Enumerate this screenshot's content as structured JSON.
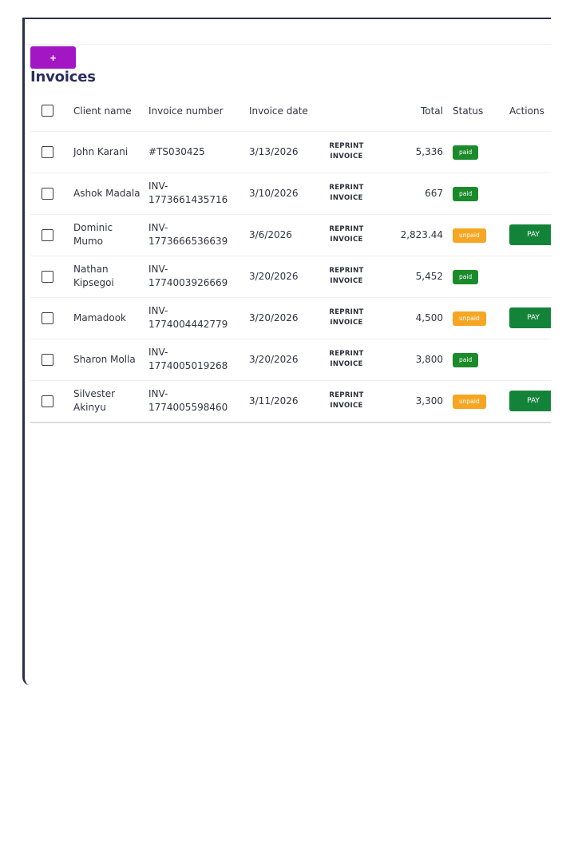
{
  "toolbar": {
    "add_label": "+"
  },
  "page": {
    "title": "Invoices"
  },
  "table": {
    "headers": {
      "client": "Client name",
      "number": "Invoice number",
      "date": "Invoice date",
      "total": "Total",
      "status": "Status",
      "actions": "Actions"
    },
    "rows": [
      {
        "client": "John Karani",
        "number": "#TS030425",
        "date": "3/13/2026",
        "reprint": "REPRINT INVOICE",
        "total": "5,336",
        "status": "paid",
        "action": ""
      },
      {
        "client": "Ashok Madala",
        "number": "INV-1773661435716",
        "date": "3/10/2026",
        "reprint": "REPRINT INVOICE",
        "total": "667",
        "status": "paid",
        "action": ""
      },
      {
        "client": "Dominic Mumo",
        "number": "INV-1773666536639",
        "date": "3/6/2026",
        "reprint": "REPRINT INVOICE",
        "total": "2,823.44",
        "status": "unpaid",
        "action": "PAY"
      },
      {
        "client": "Nathan Kipsegoi",
        "number": "INV-1774003926669",
        "date": "3/20/2026",
        "reprint": "REPRINT INVOICE",
        "total": "5,452",
        "status": "paid",
        "action": ""
      },
      {
        "client": "Mamadook",
        "number": "INV-1774004442779",
        "date": "3/20/2026",
        "reprint": "REPRINT INVOICE",
        "total": "4,500",
        "status": "unpaid",
        "action": "PAY"
      },
      {
        "client": "Sharon Molla",
        "number": "INV-1774005019268",
        "date": "3/20/2026",
        "reprint": "REPRINT INVOICE",
        "total": "3,800",
        "status": "paid",
        "action": ""
      },
      {
        "client": "Silvester Akinyu",
        "number": "INV-1774005598460",
        "date": "3/11/2026",
        "reprint": "REPRINT INVOICE",
        "total": "3,300",
        "status": "unpaid",
        "action": "PAY"
      }
    ]
  },
  "colors": {
    "accent": "#a316c4",
    "paid": "#1b8a2a",
    "unpaid": "#f5a623",
    "pay": "#14833a",
    "title": "#2b2f5e"
  }
}
